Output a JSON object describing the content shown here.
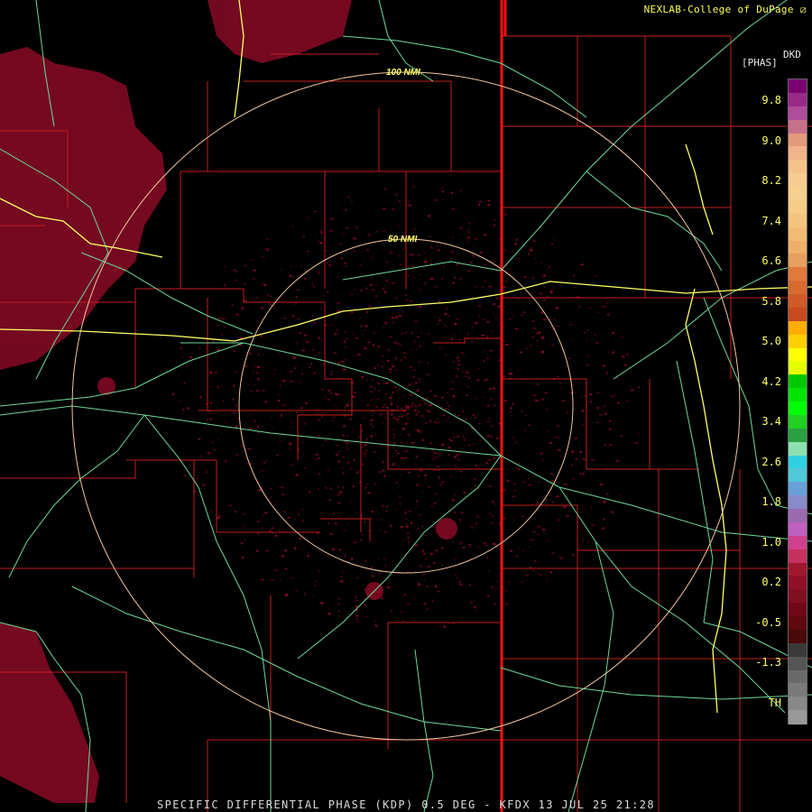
{
  "header": {
    "credit": "NEXLAB-College of DuPage",
    "credit_icon": "corner-logo-icon"
  },
  "footer": {
    "caption": "SPECIFIC DIFFERENTIAL PHASE (KDP) 0.5 DEG - KFDX 13 JUL 25 21:28"
  },
  "rings": [
    {
      "label": "100 NMI"
    },
    {
      "label": "50 NMI"
    }
  ],
  "colorbar": {
    "product": "DKD",
    "unit": "[PHAS]",
    "ticks": [
      "9.8",
      "9.0",
      "8.2",
      "7.4",
      "6.6",
      "5.8",
      "5.0",
      "4.2",
      "3.4",
      "2.6",
      "1.8",
      "1.0",
      "0.2",
      "-0.5",
      "-1.3",
      "TH"
    ],
    "swatches": [
      "#7a0070",
      "#9a2a8a",
      "#b04d9a",
      "#c9708c",
      "#e49a7a",
      "#f2b48a",
      "#f6c28c",
      "#f8cc90",
      "#f8d08e",
      "#f6cc88",
      "#f4c47e",
      "#f2bc74",
      "#efb06a",
      "#e8a060",
      "#e07a3c",
      "#d86a30",
      "#d05a28",
      "#c84a20",
      "#ffae00",
      "#ffd000",
      "#ffff00",
      "#e6ff00",
      "#00c800",
      "#00e400",
      "#00ff00",
      "#22d022",
      "#2aa040",
      "#8fe0b0",
      "#30d0e0",
      "#50c8d8",
      "#6aa0d8",
      "#8a8ac8",
      "#9a6ab0",
      "#c060c0",
      "#d04090",
      "#c83060",
      "#a01830",
      "#901028",
      "#801020",
      "#700818",
      "#600810",
      "#4a0a0a",
      "#3a3a3a",
      "#555555",
      "#6a6a6a",
      "#7a7a7a",
      "#888888",
      "#999999"
    ]
  },
  "colors": {
    "county_lines": "#c81e1e",
    "state_line": "#ff0000",
    "roads": "#6fd89a",
    "highway": "#ffff66",
    "rings": "#f2c6a0",
    "echo": "#8a0a24"
  }
}
